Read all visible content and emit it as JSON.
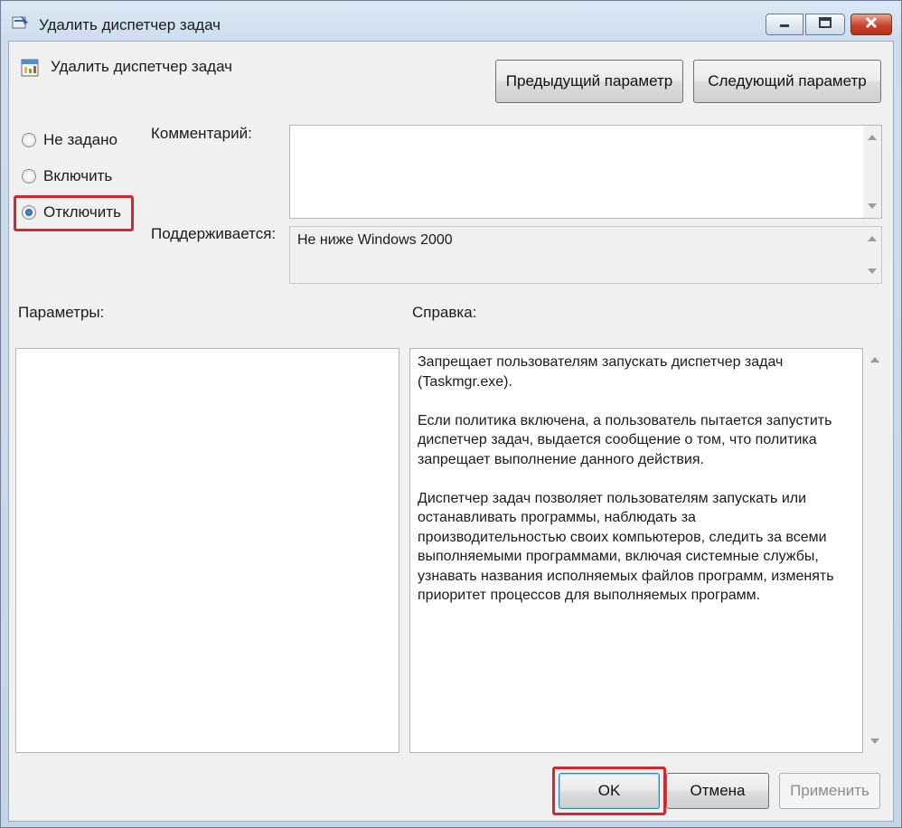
{
  "window": {
    "title": "Удалить диспетчер задач"
  },
  "header": {
    "policy_title": "Удалить диспетчер задач",
    "prev_button": "Предыдущий параметр",
    "next_button": "Следующий параметр"
  },
  "state": {
    "options": [
      {
        "label": "Не задано",
        "checked": false
      },
      {
        "label": "Включить",
        "checked": false
      },
      {
        "label": "Отключить",
        "checked": true
      }
    ]
  },
  "comment": {
    "label": "Комментарий:",
    "value": ""
  },
  "supported": {
    "label": "Поддерживается:",
    "value": "Не ниже Windows 2000"
  },
  "options_panel": {
    "label": "Параметры:"
  },
  "help_panel": {
    "label": "Справка:",
    "paragraphs": [
      "Запрещает пользователям запускать диспетчер задач\n(Taskmgr.exe).",
      "Если политика включена, а пользователь пытается запустить\nдиспетчер задач, выдается сообщение о том, что политика\nзапрещает выполнение данного действия.",
      "Диспетчер задач позволяет пользователям запускать или\nостанавливать программы, наблюдать за\nпроизводительностью своих компьютеров, следить за всеми\nвыполняемыми программами, включая системные службы,\nузнавать названия исполняемых файлов программ, изменять\nприоритет процессов для выполняемых программ."
    ]
  },
  "footer": {
    "ok": "OK",
    "cancel": "Отмена",
    "apply": "Применить"
  },
  "colors": {
    "highlight": "#d4262c",
    "close_button": "#c7432b"
  }
}
